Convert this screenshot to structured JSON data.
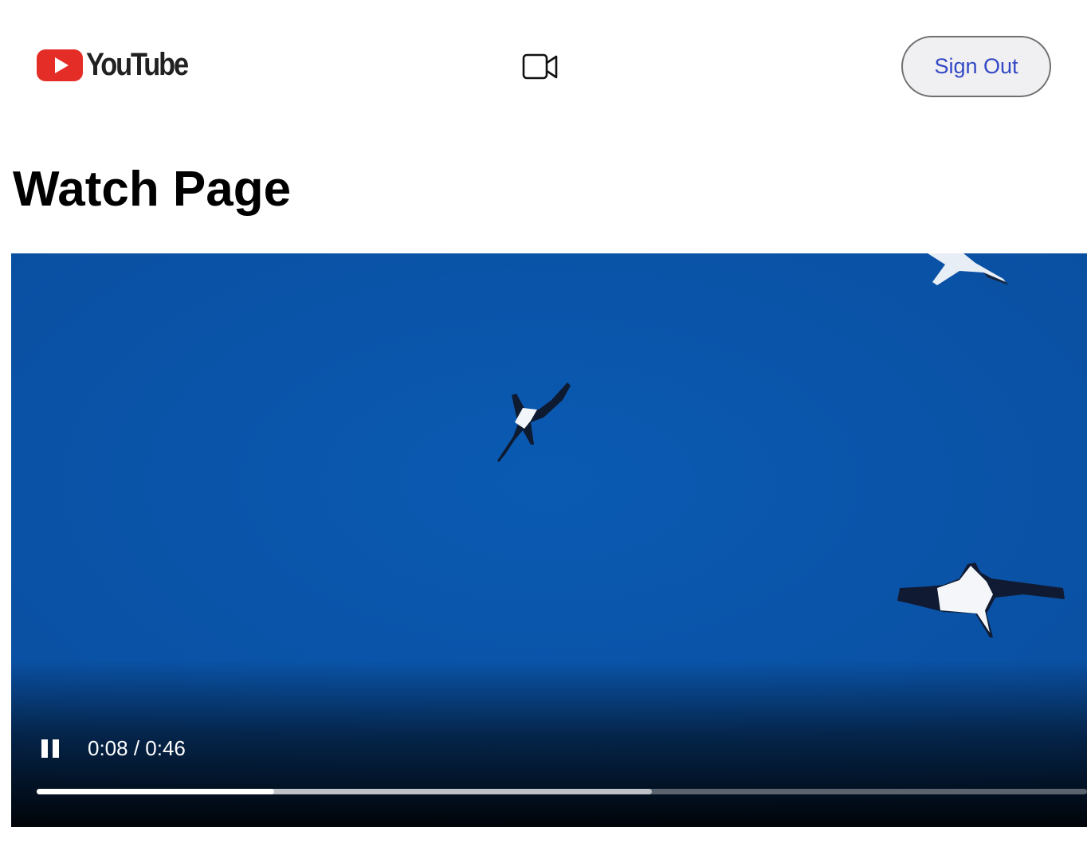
{
  "header": {
    "logo_text": "YouTube",
    "logo_icon": "youtube-play-icon",
    "brand_color": "#e52d27",
    "camera_icon": "video-camera-icon",
    "sign_out_label": "Sign Out",
    "sign_out_color": "#3348c4"
  },
  "page": {
    "title": "Watch Page"
  },
  "player": {
    "time_display": "0:08 / 0:46",
    "pause_icon": "pause-icon",
    "progress_played_fraction": 0.226,
    "progress_buffered_fraction": 0.586
  }
}
